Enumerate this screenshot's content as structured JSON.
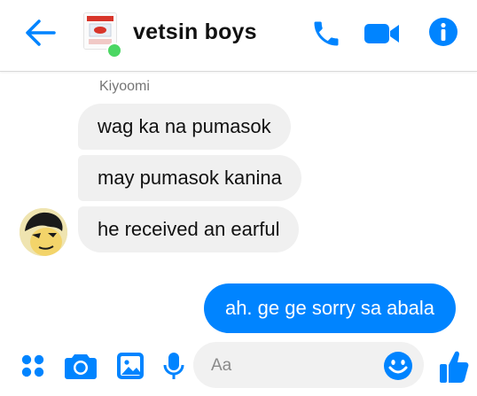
{
  "header": {
    "title": "vetsin boys",
    "back_icon": "arrow-left-icon",
    "call_icon": "phone-icon",
    "video_icon": "video-camera-icon",
    "info_icon": "info-icon",
    "accent_color": "#0084ff"
  },
  "messages": {
    "sender_name": "Kiyoomi",
    "incoming": [
      "wag ka na pumasok",
      "may pumasok kanina",
      "he received an earful"
    ],
    "outgoing": [
      "ah. ge ge sorry sa abala"
    ]
  },
  "composer": {
    "placeholder": "Aa",
    "icons": [
      "apps-icon",
      "camera-icon",
      "image-icon",
      "microphone-icon",
      "emoji-icon",
      "thumbs-up-icon"
    ]
  },
  "colors": {
    "incoming_bubble": "#f0f0f0",
    "outgoing_bubble": "#0084ff",
    "online": "#4bd763"
  }
}
